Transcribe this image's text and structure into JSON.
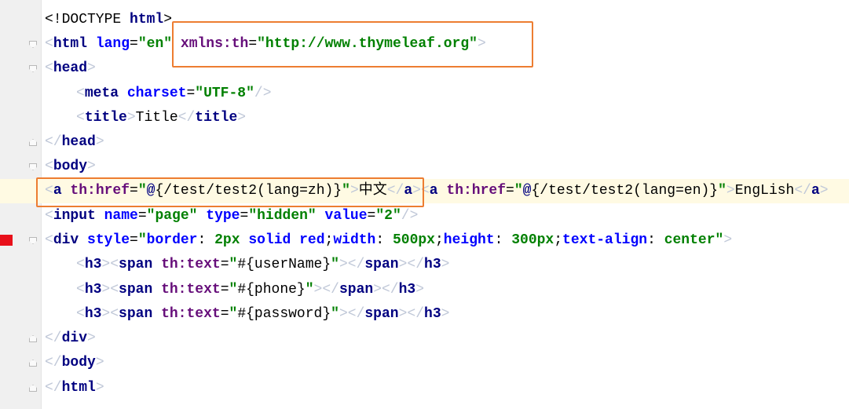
{
  "editor": {
    "lines": [
      {
        "tokens": [
          [
            "d",
            "<!DOCTYPE "
          ],
          [
            "t",
            "html"
          ],
          [
            "d",
            ">"
          ]
        ]
      },
      {
        "tokens": [
          [
            "b",
            "<"
          ],
          [
            "t",
            "html "
          ],
          [
            "a",
            "lang"
          ],
          [
            "d",
            "="
          ],
          [
            "s",
            "\"en\""
          ],
          [
            "d",
            " "
          ],
          [
            "n",
            "xmlns:th"
          ],
          [
            "d",
            "="
          ],
          [
            "s",
            "\"http://www.thymeleaf.org\""
          ],
          [
            "b",
            ">"
          ]
        ]
      },
      {
        "tokens": [
          [
            "b",
            "<"
          ],
          [
            "t",
            "head"
          ],
          [
            "b",
            ">"
          ]
        ]
      },
      {
        "tokens": [
          [
            "b",
            "<"
          ],
          [
            "t",
            "meta "
          ],
          [
            "a",
            "charset"
          ],
          [
            "d",
            "="
          ],
          [
            "s",
            "\"UTF-8\""
          ],
          [
            "b",
            "/>"
          ]
        ]
      },
      {
        "tokens": [
          [
            "b",
            "<"
          ],
          [
            "t",
            "title"
          ],
          [
            "b",
            ">"
          ],
          [
            "v",
            "Title"
          ],
          [
            "b",
            "</"
          ],
          [
            "t",
            "title"
          ],
          [
            "b",
            ">"
          ]
        ]
      },
      {
        "tokens": [
          [
            "b",
            "</"
          ],
          [
            "t",
            "head"
          ],
          [
            "b",
            ">"
          ]
        ]
      },
      {
        "tokens": [
          [
            "b",
            "<"
          ],
          [
            "t",
            "body"
          ],
          [
            "b",
            ">"
          ]
        ]
      },
      {
        "tokens": [
          [
            "b",
            "<"
          ],
          [
            "t",
            "a "
          ],
          [
            "n",
            "th:href"
          ],
          [
            "d",
            "="
          ],
          [
            "s",
            "\""
          ],
          [
            "t",
            "@"
          ],
          [
            "v",
            "{/test/test2(lang=zh)}"
          ],
          [
            "s",
            "\""
          ],
          [
            "b",
            ">"
          ],
          [
            "v",
            "中文"
          ],
          [
            "b",
            "</"
          ],
          [
            "t",
            "a"
          ],
          [
            "b",
            ">"
          ],
          [
            "b",
            "<"
          ],
          [
            "t",
            "a "
          ],
          [
            "n",
            "th:href"
          ],
          [
            "d",
            "="
          ],
          [
            "s",
            "\""
          ],
          [
            "t",
            "@"
          ],
          [
            "v",
            "{/test/test2(lang=en)}"
          ],
          [
            "s",
            "\""
          ],
          [
            "b",
            ">"
          ],
          [
            "v",
            "EngLish"
          ],
          [
            "b",
            "</"
          ],
          [
            "t",
            "a"
          ],
          [
            "b",
            ">"
          ]
        ]
      },
      {
        "tokens": [
          [
            "b",
            "<"
          ],
          [
            "t",
            "input "
          ],
          [
            "a",
            "name"
          ],
          [
            "d",
            "="
          ],
          [
            "s",
            "\"page\" "
          ],
          [
            "a",
            "type"
          ],
          [
            "d",
            "="
          ],
          [
            "s",
            "\"hidden\" "
          ],
          [
            "a",
            "value"
          ],
          [
            "d",
            "="
          ],
          [
            "s",
            "\"2\""
          ],
          [
            "b",
            "/>"
          ]
        ]
      },
      {
        "tokens": [
          [
            "b",
            "<"
          ],
          [
            "t",
            "div "
          ],
          [
            "a",
            "style"
          ],
          [
            "d",
            "="
          ],
          [
            "s",
            "\""
          ],
          [
            "a",
            "border"
          ],
          [
            "d",
            ": "
          ],
          [
            "s",
            "2px "
          ],
          [
            "a",
            "solid red"
          ],
          [
            "d",
            ";"
          ],
          [
            "a",
            "width"
          ],
          [
            "d",
            ": "
          ],
          [
            "s",
            "500px"
          ],
          [
            "d",
            ";"
          ],
          [
            "a",
            "height"
          ],
          [
            "d",
            ": "
          ],
          [
            "s",
            "300px"
          ],
          [
            "d",
            ";"
          ],
          [
            "a",
            "text-align"
          ],
          [
            "d",
            ": "
          ],
          [
            "s",
            "center"
          ],
          [
            "s",
            "\""
          ],
          [
            "b",
            ">"
          ]
        ]
      },
      {
        "tokens": [
          [
            "b",
            "<"
          ],
          [
            "t",
            "h3"
          ],
          [
            "b",
            ">"
          ],
          [
            "b",
            "<"
          ],
          [
            "t",
            "span "
          ],
          [
            "n",
            "th:text"
          ],
          [
            "d",
            "="
          ],
          [
            "s",
            "\""
          ],
          [
            "v",
            "#{userName}"
          ],
          [
            "s",
            "\""
          ],
          [
            "b",
            ">"
          ],
          [
            "b",
            "</"
          ],
          [
            "t",
            "span"
          ],
          [
            "b",
            ">"
          ],
          [
            "b",
            "</"
          ],
          [
            "t",
            "h3"
          ],
          [
            "b",
            ">"
          ]
        ]
      },
      {
        "tokens": [
          [
            "b",
            "<"
          ],
          [
            "t",
            "h3"
          ],
          [
            "b",
            ">"
          ],
          [
            "b",
            "<"
          ],
          [
            "t",
            "span "
          ],
          [
            "n",
            "th:text"
          ],
          [
            "d",
            "="
          ],
          [
            "s",
            "\""
          ],
          [
            "v",
            "#{phone}"
          ],
          [
            "s",
            "\""
          ],
          [
            "b",
            ">"
          ],
          [
            "b",
            "</"
          ],
          [
            "t",
            "span"
          ],
          [
            "b",
            ">"
          ],
          [
            "b",
            "</"
          ],
          [
            "t",
            "h3"
          ],
          [
            "b",
            ">"
          ]
        ]
      },
      {
        "tokens": [
          [
            "b",
            "<"
          ],
          [
            "t",
            "h3"
          ],
          [
            "b",
            ">"
          ],
          [
            "b",
            "<"
          ],
          [
            "t",
            "span "
          ],
          [
            "n",
            "th:text"
          ],
          [
            "d",
            "="
          ],
          [
            "s",
            "\""
          ],
          [
            "v",
            "#{password}"
          ],
          [
            "s",
            "\""
          ],
          [
            "b",
            ">"
          ],
          [
            "b",
            "</"
          ],
          [
            "t",
            "span"
          ],
          [
            "b",
            ">"
          ],
          [
            "b",
            "</"
          ],
          [
            "t",
            "h3"
          ],
          [
            "b",
            ">"
          ]
        ]
      },
      {
        "tokens": [
          [
            "b",
            "</"
          ],
          [
            "t",
            "div"
          ],
          [
            "b",
            ">"
          ]
        ]
      },
      {
        "tokens": [
          [
            "b",
            "</"
          ],
          [
            "t",
            "body"
          ],
          [
            "b",
            ">"
          ]
        ]
      },
      {
        "tokens": [
          [
            "b",
            "</"
          ],
          [
            "t",
            "html"
          ],
          [
            "b",
            ">"
          ]
        ]
      }
    ]
  },
  "colors": {
    "highlight_box": "#ed7d31",
    "breakpoint": "#e8101a",
    "current_line": "#fffae3"
  }
}
